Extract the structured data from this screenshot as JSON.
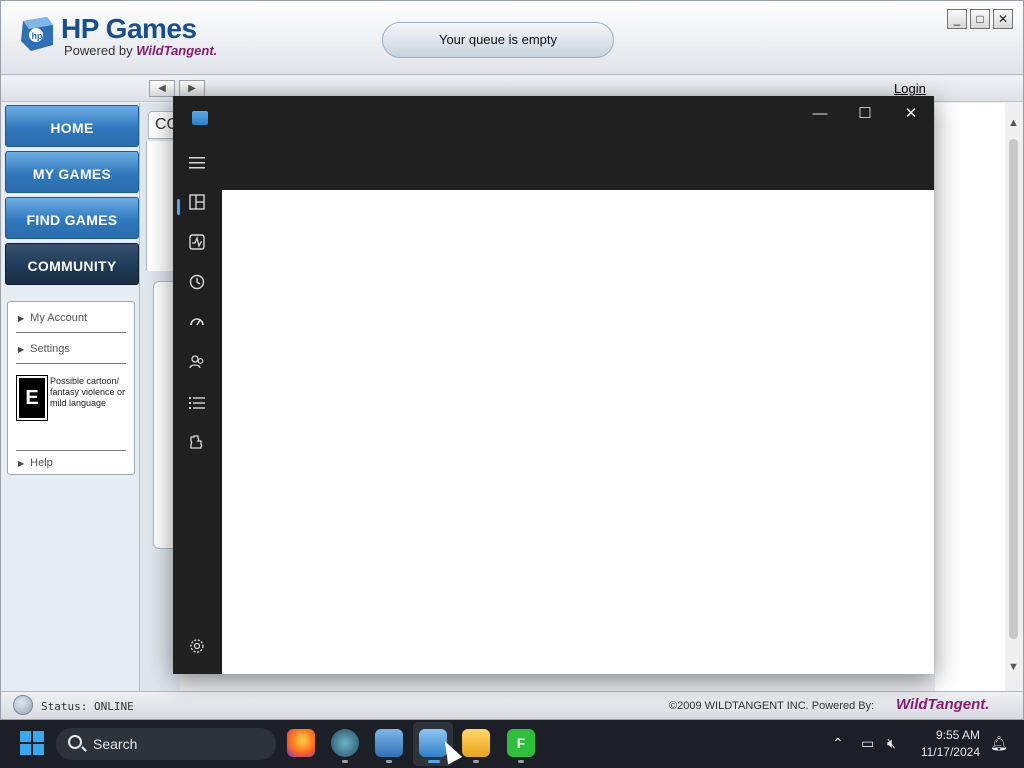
{
  "hp_window": {
    "title": "HP Games",
    "powered_prefix": "Powered by",
    "powered_brand": "WildTangent.",
    "queue_status": "Your queue is empty",
    "login_label": "Login",
    "window_controls": {
      "minimize": "_",
      "maximize": "□",
      "close": "✕"
    },
    "nav_back": "◀",
    "nav_forward": "▶"
  },
  "sidebar": {
    "nav": [
      {
        "label": "HOME"
      },
      {
        "label": "MY GAMES"
      },
      {
        "label": "FIND GAMES"
      },
      {
        "label": "COMMUNITY"
      }
    ],
    "links": {
      "my_account": "My Account",
      "settings": "Settings",
      "help": "Help"
    },
    "esrb": {
      "rating": "E",
      "description": "Possible cartoon/ fantasy violence or mild language"
    }
  },
  "content": {
    "tab_label": "CO"
  },
  "status_bar": {
    "status_text": "Status: ONLINE",
    "copyright": "©2009 WILDTANGENT INC. Powered By:",
    "brand": "WildTangent."
  },
  "dark_app": {
    "controls": {
      "minimize": "—",
      "maximize": "☐",
      "close": "✕"
    },
    "rail_icons": [
      "menu-icon",
      "overview-icon",
      "performance-icon",
      "history-icon",
      "startup-icon",
      "users-icon",
      "details-icon",
      "services-icon",
      "settings-icon"
    ]
  },
  "taskbar": {
    "search_label": "Search",
    "time": "9:55 AM",
    "date": "11/17/2024",
    "apps": [
      "firefox-icon",
      "n-app-icon",
      "hp-games-icon",
      "dark-app-icon",
      "file-explorer-icon",
      "f-app-icon"
    ]
  }
}
